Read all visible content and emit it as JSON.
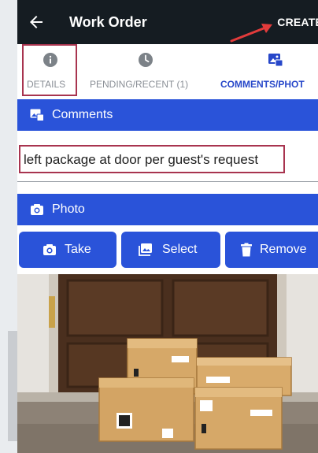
{
  "appbar": {
    "title": "Work Order",
    "create_label": "CREATE",
    "back_icon": "arrow-left-icon"
  },
  "tabs": [
    {
      "label": "DETAILS",
      "icon": "info-icon",
      "active": false
    },
    {
      "label": "PENDING/RECENT (1)",
      "icon": "clock-icon",
      "active": false
    },
    {
      "label": "COMMENTS/PHOT",
      "icon": "image-icon",
      "active": true
    }
  ],
  "comments": {
    "header": "Comments",
    "icon": "image-icon",
    "text": "left package at door per guest's request"
  },
  "photo": {
    "header": "Photo",
    "icon": "camera-icon",
    "buttons": {
      "take": "Take",
      "select": "Select",
      "remove": "Remove"
    },
    "image_subject": "cardboard packages at front door"
  },
  "colors": {
    "appbar": "#151c22",
    "primary": "#2a53d9",
    "highlight_border": "#a8344f",
    "annotation_arrow": "#e23b3b"
  }
}
